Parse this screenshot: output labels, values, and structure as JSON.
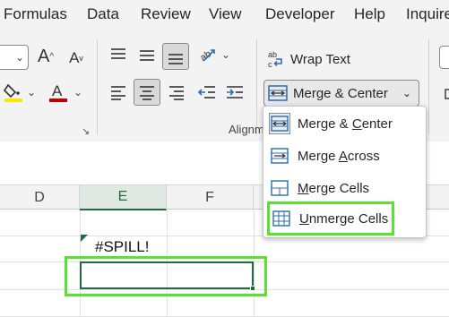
{
  "menubar": {
    "items": [
      "Formulas",
      "Data",
      "Review",
      "View",
      "Developer",
      "Help",
      "Inquire"
    ]
  },
  "ribbon": {
    "alignment_group_label": "Alignm",
    "wrap_text_label": "Wrap Text",
    "merge_center_label": "Merge & Center",
    "font_color_accent": "#c00000",
    "fill_color_accent": "#ffe600"
  },
  "dropdown": {
    "items": [
      {
        "label": "Merge & Center",
        "underline_char": "C",
        "prefix": "Merge & ",
        "suffix": "enter",
        "icon": "merge-center-icon"
      },
      {
        "label": "Merge Across",
        "underline_char": "A",
        "prefix": "Merge ",
        "suffix": "cross",
        "icon": "merge-across-icon"
      },
      {
        "label": "Merge Cells",
        "underline_char": "M",
        "prefix": "",
        "suffix": "erge Cells",
        "icon": "merge-cells-icon"
      },
      {
        "label": "Unmerge Cells",
        "underline_char": "U",
        "prefix": "",
        "suffix": "nmerge Cells",
        "icon": "unmerge-cells-icon"
      }
    ]
  },
  "sheet": {
    "columns": [
      "D",
      "E",
      "F"
    ],
    "active_column": "E",
    "cell_error_text": "#SPILL!"
  },
  "colors": {
    "excel_green": "#1e6b3c",
    "highlight_green": "#57e32f",
    "accent_blue": "#2b6cb0"
  }
}
